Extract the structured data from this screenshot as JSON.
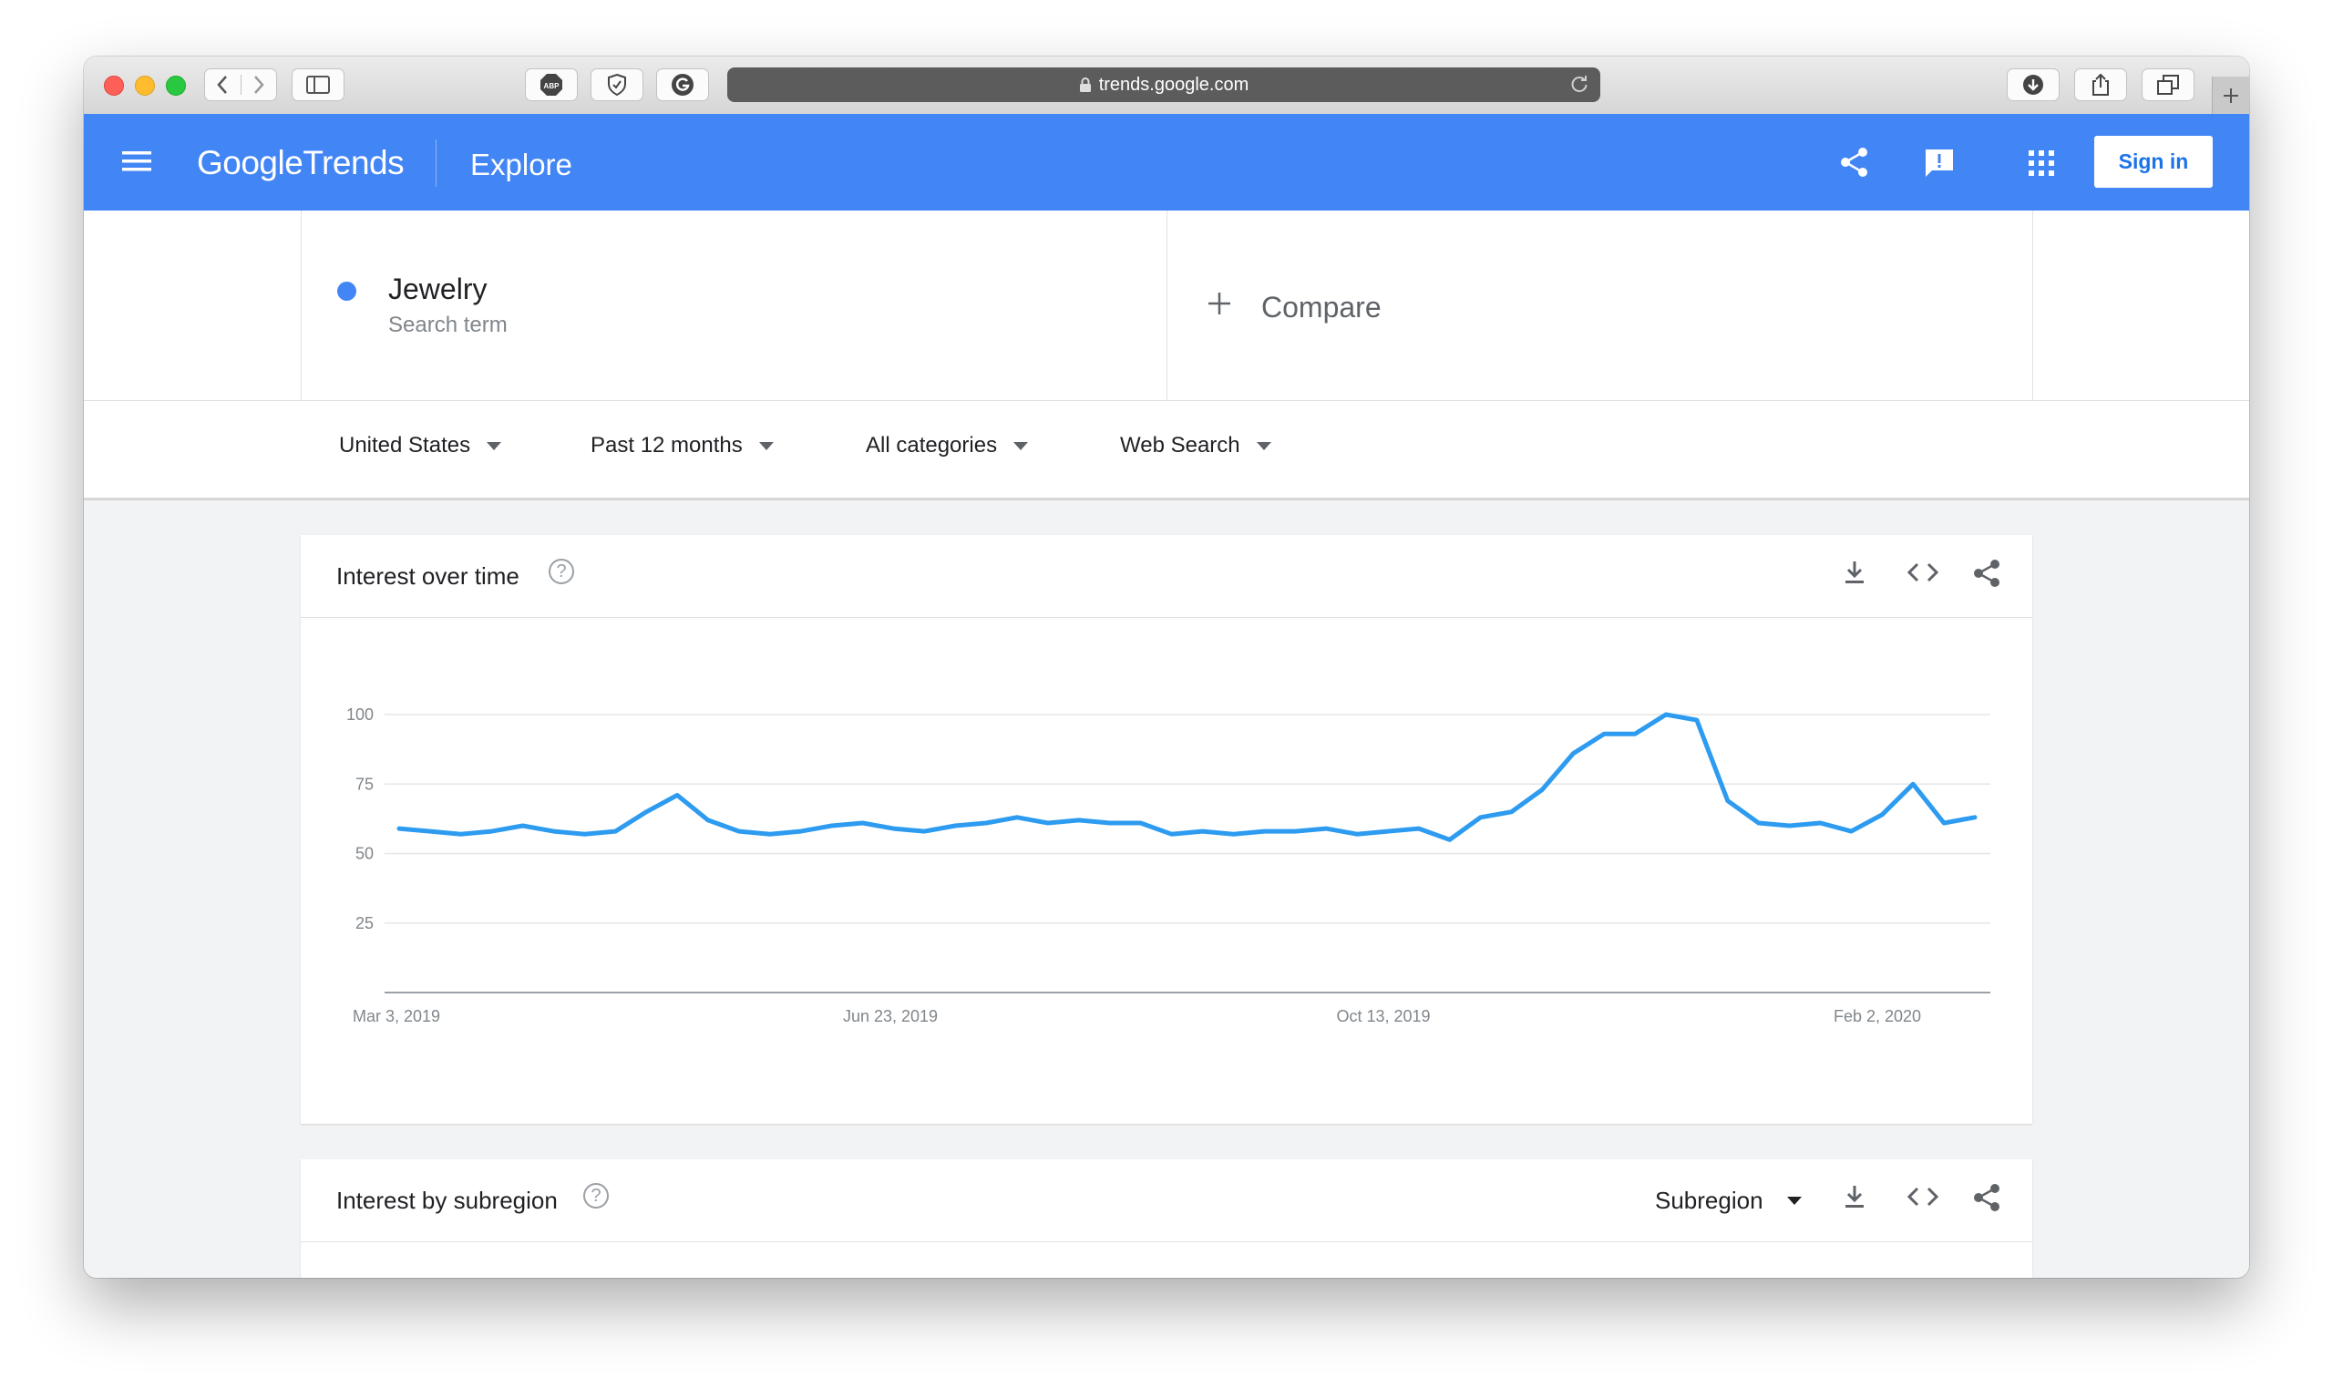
{
  "browser": {
    "url": "trends.google.com",
    "extension_abp": "ABP"
  },
  "header": {
    "logo_google": "Google",
    "logo_trends": "Trends",
    "section": "Explore",
    "sign_in": "Sign in",
    "colors": {
      "bar": "#4285f4"
    }
  },
  "search": {
    "term": "Jewelry",
    "term_type": "Search term",
    "term_color": "#4285f4",
    "compare": "Compare"
  },
  "filters": {
    "region": "United States",
    "time": "Past 12 months",
    "category": "All categories",
    "property": "Web Search"
  },
  "cards": {
    "interest_over_time": "Interest over time",
    "interest_by_subregion": "Interest by subregion",
    "subregion_select": "Subregion",
    "help_glyph": "?"
  },
  "chart_data": {
    "type": "line",
    "title": "Interest over time",
    "x_tick_labels": [
      "Mar 3, 2019",
      "Jun 23, 2019",
      "Oct 13, 2019",
      "Feb 2, 2020"
    ],
    "y_ticks": [
      25,
      50,
      75,
      100
    ],
    "ylim": [
      0,
      100
    ],
    "grid": true,
    "series": [
      {
        "color": "#2d9bf0",
        "values": [
          59,
          58,
          57,
          58,
          60,
          58,
          57,
          58,
          65,
          71,
          62,
          58,
          57,
          58,
          60,
          61,
          59,
          58,
          60,
          61,
          63,
          61,
          62,
          61,
          61,
          57,
          58,
          57,
          58,
          58,
          59,
          57,
          58,
          59,
          55,
          63,
          65,
          73,
          86,
          93,
          93,
          100,
          98,
          69,
          61,
          60,
          61,
          58,
          64,
          75,
          61,
          63
        ]
      }
    ]
  }
}
